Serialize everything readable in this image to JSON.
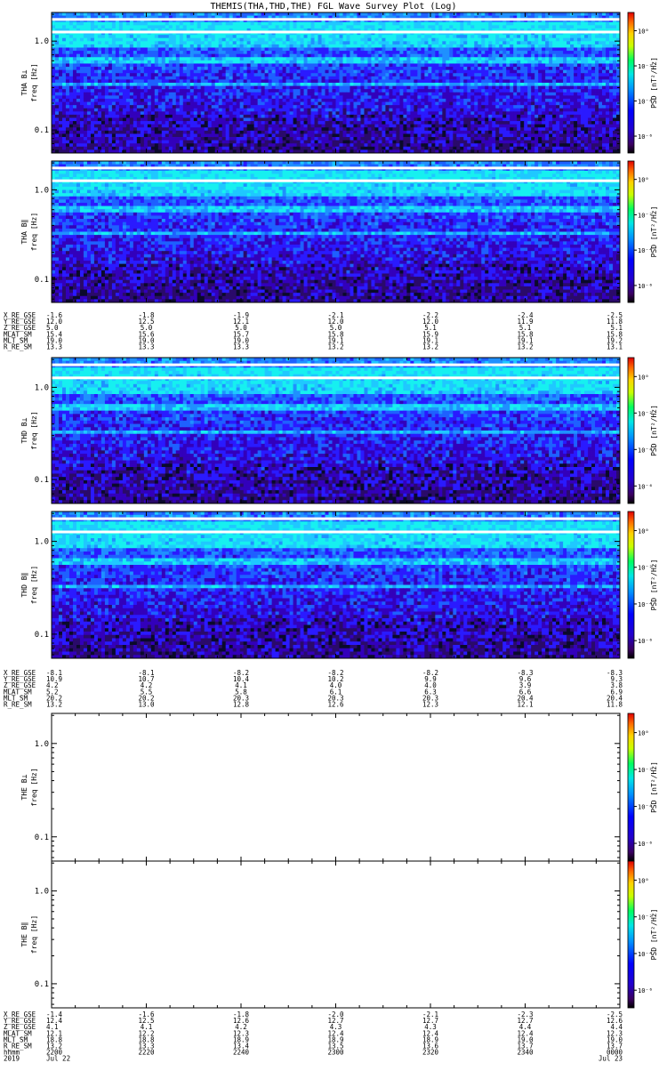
{
  "chart_data": {
    "type": "heatmap",
    "title": "THEMIS(THA,THD,THE) FGL Wave Survey Plot (Log)",
    "y_scale": "log",
    "yticks": [
      "1.0",
      "0.1"
    ],
    "colorbar": {
      "label": "PSD [nT²/Hz]",
      "scale": "log",
      "ticks": [
        "10⁰",
        "10⁻²",
        "10⁻⁴",
        "10⁻⁶"
      ]
    },
    "panels": [
      {
        "id": "tha_bl",
        "ylabel_top": "THA B⊥",
        "ylabel": "freq [Hz]",
        "data": true
      },
      {
        "id": "tha_bpar",
        "ylabel_top": "THA B∥",
        "ylabel": "freq [Hz]",
        "data": true
      },
      {
        "id": "thd_bl",
        "ylabel_top": "THD B⊥",
        "ylabel": "freq [Hz]",
        "data": true
      },
      {
        "id": "thd_bpar",
        "ylabel_top": "THD B∥",
        "ylabel": "freq [Hz]",
        "data": true
      },
      {
        "id": "the_bl",
        "ylabel_top": "THE B⊥",
        "ylabel": "freq [Hz]",
        "data": false
      },
      {
        "id": "the_bpar",
        "ylabel_top": "THE B∥",
        "ylabel": "freq [Hz]",
        "data": false
      }
    ],
    "ephemeris_blocks": [
      {
        "id": "tha",
        "rows": [
          {
            "label": "X_RE_GSE",
            "values": [
              "-1.6",
              "-1.8",
              "-1.9",
              "-2.1",
              "-2.2",
              "-2.4",
              "-2.5"
            ]
          },
          {
            "label": "Y_RE_GSE",
            "values": [
              "12.0",
              "12.5",
              "12.1",
              "12.0",
              "12.0",
              "11.9",
              "11.8"
            ]
          },
          {
            "label": "Z_RE_GSE",
            "values": [
              "5.0",
              "5.0",
              "5.0",
              "5.0",
              "5.1",
              "5.1",
              "5.1"
            ]
          },
          {
            "label": "MLAT_SM",
            "values": [
              "15.4",
              "15.6",
              "15.7",
              "15.8",
              "15.9",
              "15.8",
              "15.8"
            ]
          },
          {
            "label": "MLT_SM",
            "values": [
              "19.0",
              "19.0",
              "19.0",
              "19.1",
              "19.1",
              "19.1",
              "19.2"
            ]
          },
          {
            "label": "R_RE_SM",
            "values": [
              "13.3",
              "13.3",
              "13.3",
              "13.2",
              "13.2",
              "13.2",
              "13.1"
            ]
          }
        ]
      },
      {
        "id": "thd",
        "rows": [
          {
            "label": "X_RE_GSE",
            "values": [
              "-8.1",
              "-8.1",
              "-8.2",
              "-8.2",
              "-8.2",
              "-8.3",
              "-8.3"
            ]
          },
          {
            "label": "Y_RE_GSE",
            "values": [
              "10.9",
              "10.7",
              "10.4",
              "10.2",
              "9.9",
              "9.6",
              "9.3"
            ]
          },
          {
            "label": "Z_RE_GSE",
            "values": [
              "4.2",
              "4.2",
              "4.1",
              "4.0",
              "4.0",
              "3.9",
              "3.8"
            ]
          },
          {
            "label": "MLAT_SM",
            "values": [
              "5.2",
              "5.5",
              "5.8",
              "6.1",
              "6.3",
              "6.6",
              "6.9"
            ]
          },
          {
            "label": "MLT_SM",
            "values": [
              "20.2",
              "20.2",
              "20.3",
              "20.3",
              "20.3",
              "20.4",
              "20.4"
            ]
          },
          {
            "label": "R_RE_SM",
            "values": [
              "13.2",
              "13.0",
              "12.8",
              "12.6",
              "12.3",
              "12.1",
              "11.8"
            ]
          }
        ]
      },
      {
        "id": "the",
        "rows": [
          {
            "label": "X_RE_GSE",
            "values": [
              "-1.4",
              "-1.6",
              "-1.8",
              "-2.0",
              "-2.1",
              "-2.3",
              "-2.5"
            ]
          },
          {
            "label": "Y_RE_GSE",
            "values": [
              "12.4",
              "12.5",
              "12.6",
              "12.7",
              "12.7",
              "12.7",
              "12.6"
            ]
          },
          {
            "label": "Z_RE_GSE",
            "values": [
              "4.1",
              "4.1",
              "4.2",
              "4.3",
              "4.3",
              "4.4",
              "4.4"
            ]
          },
          {
            "label": "MLAT_SM",
            "values": [
              "12.1",
              "12.2",
              "12.3",
              "12.4",
              "12.4",
              "12.4",
              "12.3"
            ]
          },
          {
            "label": "MLT_SM",
            "values": [
              "18.8",
              "18.8",
              "18.9",
              "18.9",
              "18.9",
              "19.0",
              "19.0"
            ]
          },
          {
            "label": "R_RE_SM",
            "values": [
              "13.2",
              "13.3",
              "13.4",
              "13.5",
              "13.6",
              "13.7",
              "13.7"
            ]
          },
          {
            "label": "hhmm",
            "values": [
              "2200",
              "2220",
              "2240",
              "2300",
              "2320",
              "2340",
              "0000"
            ]
          },
          {
            "label": "2019",
            "values": [
              "Jul 22",
              "",
              "",
              "",
              "",
              "",
              "Jul 23"
            ]
          }
        ]
      }
    ]
  }
}
